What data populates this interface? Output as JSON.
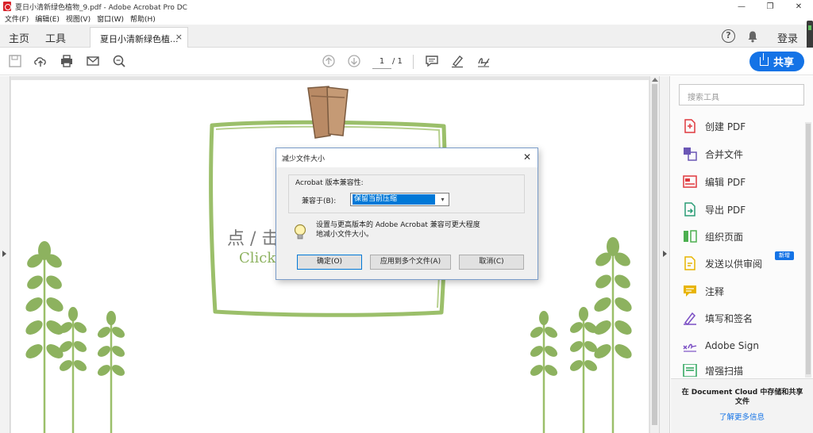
{
  "window": {
    "title": "夏日小清新绿色植物_9.pdf - Adobe Acrobat Pro DC",
    "controls": {
      "minimize": "—",
      "restore": "❐",
      "close": "✕"
    }
  },
  "menu": [
    "文件(F)",
    "编辑(E)",
    "视图(V)",
    "窗口(W)",
    "帮助(H)"
  ],
  "tabbar": {
    "home": "主页",
    "tools": "工具",
    "doc_tab": "夏日小清新绿色植...",
    "close": "×",
    "help": "?",
    "login": "登录"
  },
  "toolbar": {
    "page_current": "1",
    "page_total": "/ 1",
    "share": "共享"
  },
  "page_content": {
    "title_partial": "点 / 击",
    "subtitle_partial": "Click"
  },
  "tools_panel": {
    "search_placeholder": "搜索工具",
    "items": [
      {
        "label": "创建 PDF",
        "icon": "create-pdf-icon",
        "color": "#e0393e"
      },
      {
        "label": "合并文件",
        "icon": "combine-files-icon",
        "color": "#6b56b5"
      },
      {
        "label": "编辑 PDF",
        "icon": "edit-pdf-icon",
        "color": "#e0393e"
      },
      {
        "label": "导出 PDF",
        "icon": "export-pdf-icon",
        "color": "#2a9d76"
      },
      {
        "label": "组织页面",
        "icon": "organize-pages-icon",
        "color": "#4caf50"
      },
      {
        "label": "发送以供审阅",
        "icon": "send-review-icon",
        "color": "#e8b400"
      },
      {
        "label": "注释",
        "icon": "comment-icon",
        "color": "#e8b400"
      },
      {
        "label": "填写和签名",
        "icon": "fill-sign-icon",
        "color": "#7b4fc4"
      },
      {
        "label": "Adobe Sign",
        "icon": "adobe-sign-icon",
        "color": "#7b4fc4"
      },
      {
        "label": "增强扫描",
        "icon": "enhance-scan-icon",
        "color": "#2aa55b"
      }
    ],
    "new_badge": "新增",
    "cloud_text": "在 Document Cloud 中存储和共享文件",
    "cloud_link": "了解更多信息"
  },
  "dialog": {
    "title": "减少文件大小",
    "close": "✕",
    "group_label": "Acrobat 版本兼容性:",
    "field_label": "兼容于(B):",
    "select_value": "保留当前压缩",
    "info": "设置与更高版本的 Adobe Acrobat 兼容可更大程度地减小文件大小。",
    "buttons": {
      "ok": "确定(O)",
      "apply_multiple": "应用到多个文件(A)",
      "cancel": "取消(C)"
    }
  },
  "colors": {
    "accent": "#1473e6",
    "plant_green": "#8db25f",
    "frame_green": "#9bbf6a",
    "clip_brown": "#b98a65"
  }
}
